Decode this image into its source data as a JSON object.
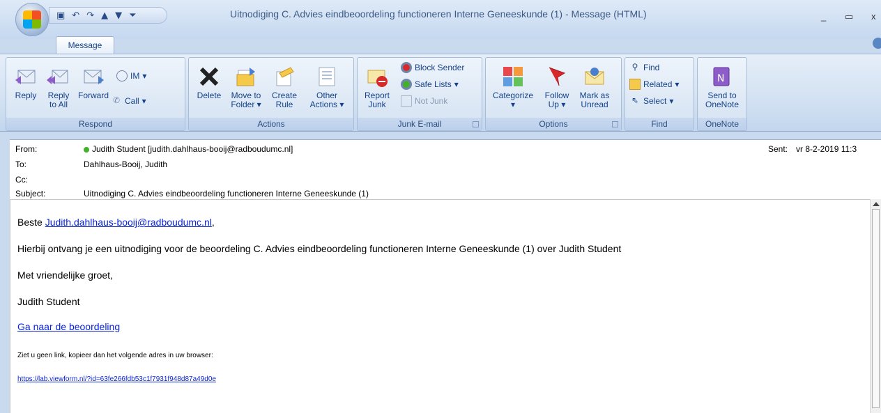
{
  "window": {
    "title": "Uitnodiging C. Advies eindbeoordeling functioneren Interne Geneeskunde (1) - Message (HTML)",
    "minimize": "_",
    "maximize": "▭",
    "close": "x"
  },
  "tabs": {
    "active": "Message"
  },
  "ribbon": {
    "respond": {
      "label": "Respond",
      "reply": "Reply",
      "reply_all_1": "Reply",
      "reply_all_2": "to All",
      "forward": "Forward",
      "im": "IM",
      "call": "Call"
    },
    "actions": {
      "label": "Actions",
      "delete": "Delete",
      "move_1": "Move to",
      "move_2": "Folder",
      "create_1": "Create",
      "create_2": "Rule",
      "other_1": "Other",
      "other_2": "Actions"
    },
    "junk": {
      "label": "Junk E-mail",
      "report_1": "Report",
      "report_2": "Junk",
      "block": "Block Sender",
      "safe": "Safe Lists",
      "notjunk": "Not Junk"
    },
    "options": {
      "label": "Options",
      "categorize": "Categorize",
      "follow_1": "Follow",
      "follow_2": "Up",
      "mark_1": "Mark as",
      "mark_2": "Unread"
    },
    "find": {
      "label": "Find",
      "find": "Find",
      "related": "Related",
      "select": "Select"
    },
    "onenote": {
      "label": "OneNote",
      "send_1": "Send to",
      "send_2": "OneNote"
    }
  },
  "header": {
    "from_label": "From:",
    "from_value": "Judith Student [judith.dahlhaus-booij@radboudumc.nl]",
    "to_label": "To:",
    "to_value": "Dahlhaus-Booij, Judith",
    "cc_label": "Cc:",
    "cc_value": "",
    "subject_label": "Subject:",
    "subject_value": "Uitnodiging C. Advies eindbeoordeling functioneren Interne Geneeskunde (1)",
    "sent_label": "Sent:",
    "sent_value": "vr 8-2-2019 11:3"
  },
  "body": {
    "greeting": "Beste",
    "greeting_link": "Judith.dahlhaus-booij@radboudumc.nl",
    "greeting_end": ",",
    "line1": "Hierbij ontvang je een uitnodiging voor de beoordeling C. Advies eindbeoordeling functioneren Interne Geneeskunde (1) over Judith Student",
    "line2": "Met vriendelijke groet,",
    "line3": "Judith Student",
    "link_text": "Ga naar de beoordeling",
    "note": "Ziet u geen link, kopieer dan het volgende adres in uw browser:",
    "url": "https://lab.viewform.nl/?id=63fe266fdb53c1f7931f948d87a49d0e"
  }
}
